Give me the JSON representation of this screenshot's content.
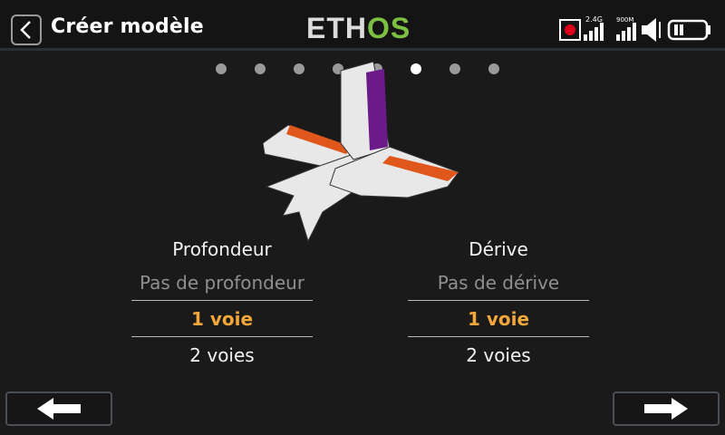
{
  "header": {
    "title": "Créer modèle",
    "logo_part1": "ETH",
    "logo_part2": "OS",
    "signal_24_label": "2.4G",
    "signal_900_label": "900M"
  },
  "pager": {
    "total": 8,
    "active_index": 5
  },
  "columns": [
    {
      "heading": "Profondeur",
      "options": [
        "Pas de profondeur",
        "1 voie",
        "2 voies"
      ],
      "selected": "1 voie"
    },
    {
      "heading": "Dérive",
      "options": [
        "Pas de dérive",
        "1 voie",
        "2 voies"
      ],
      "selected": "1 voie"
    }
  ],
  "icons": {
    "back": "chevron-left-icon",
    "prev": "arrow-left-icon",
    "next": "arrow-right-icon",
    "record": "record-icon",
    "speaker": "speaker-icon",
    "battery": "battery-icon"
  },
  "colors": {
    "accent_selected": "#f2a73b",
    "logo_green": "#7bc043",
    "elevator": "#e0571b",
    "rudder": "#6b1a8a",
    "record": "#e0001b"
  }
}
